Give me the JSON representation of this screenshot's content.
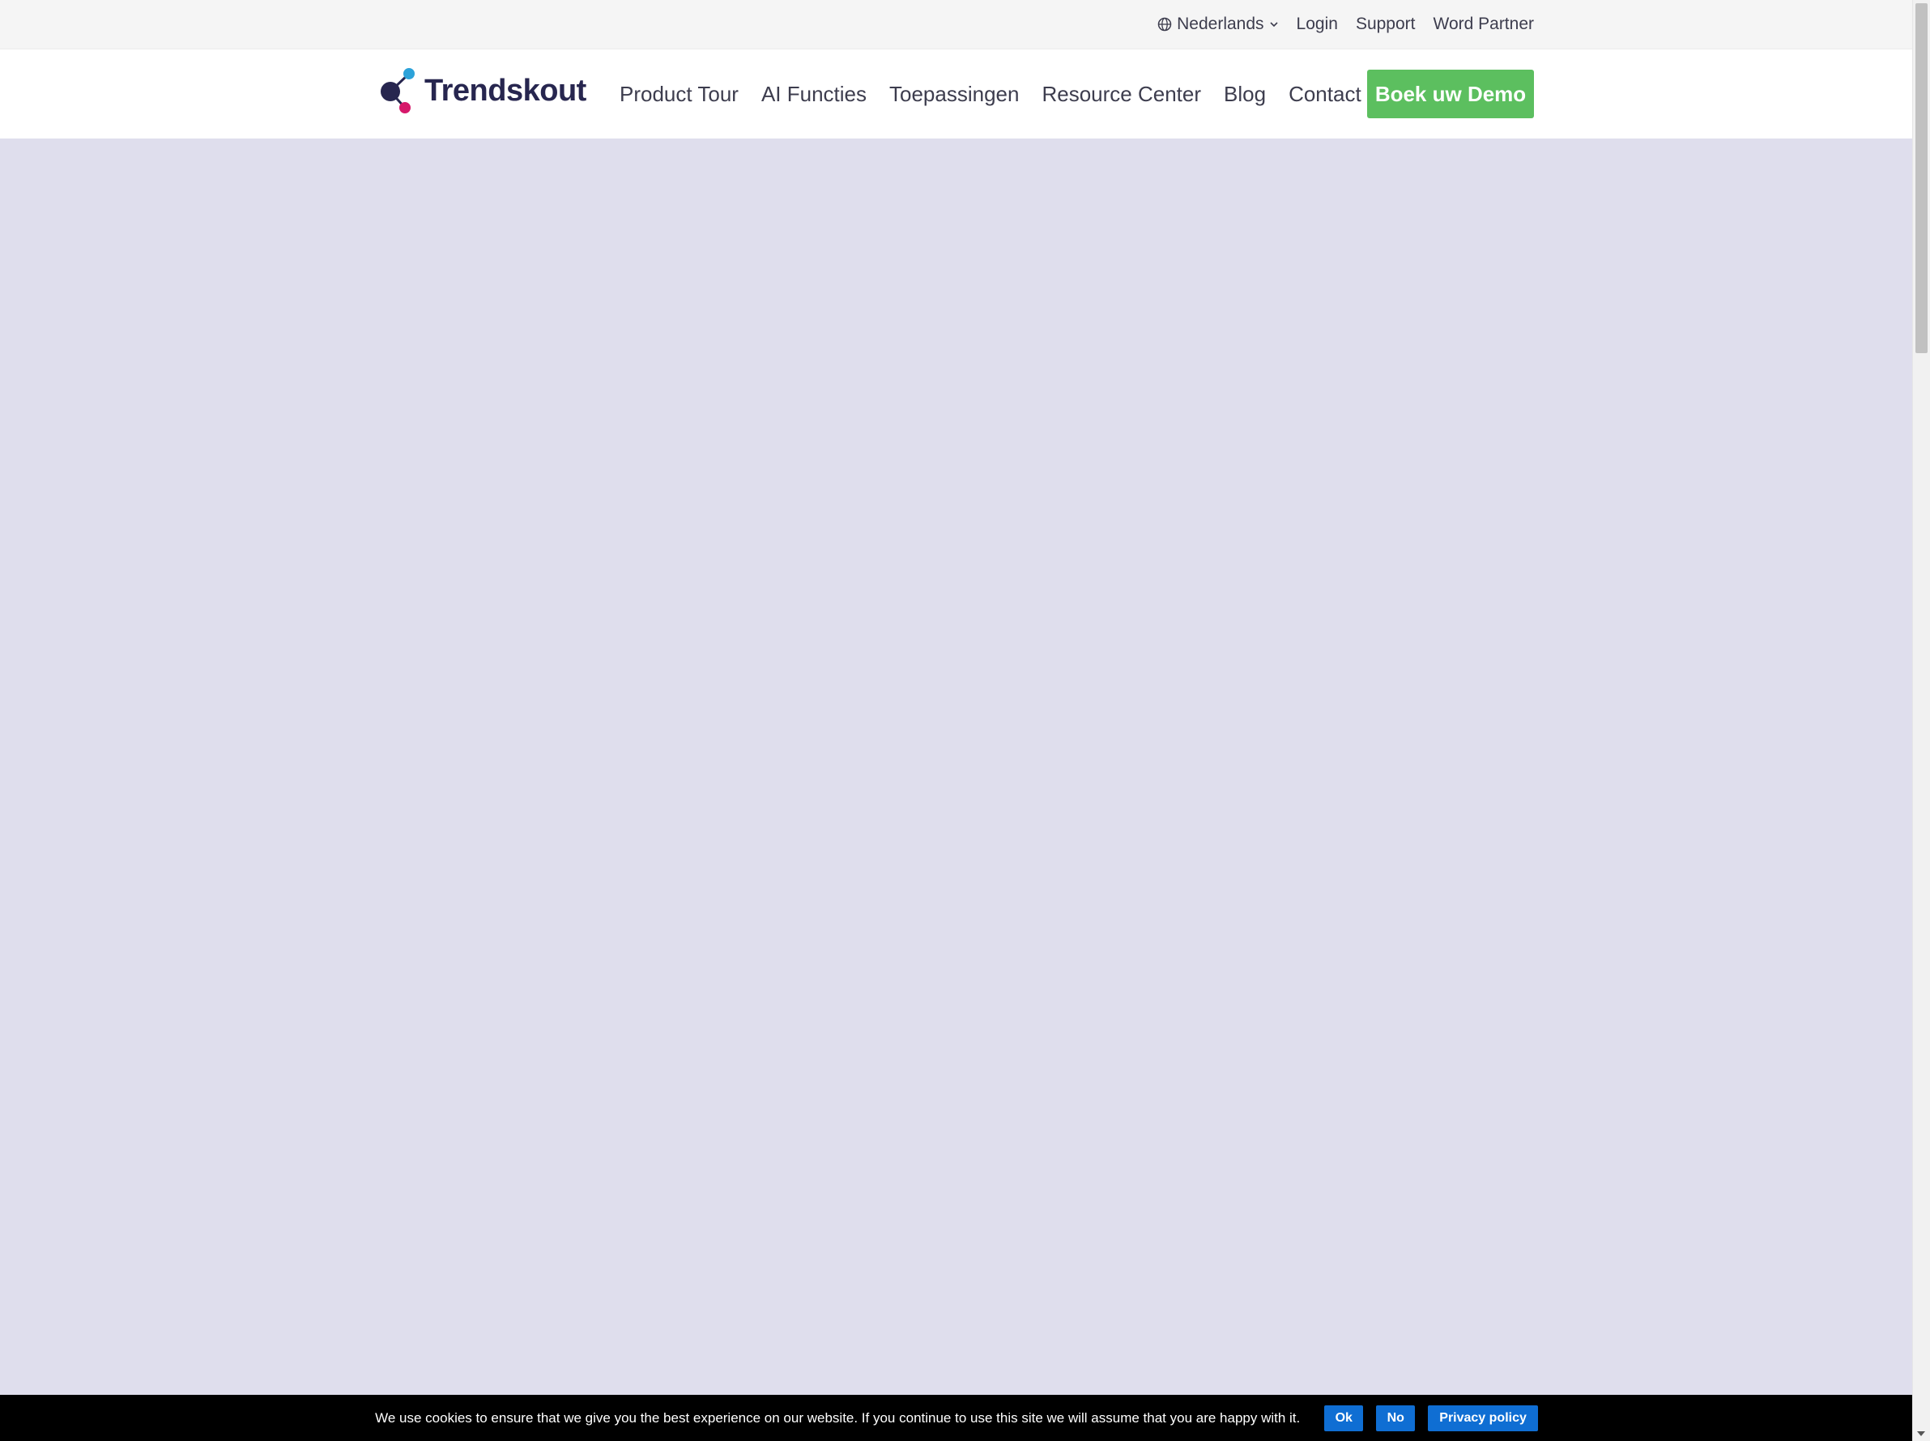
{
  "topbar": {
    "language": "Nederlands",
    "links": [
      "Login",
      "Support",
      "Word Partner"
    ]
  },
  "header": {
    "logo_text": "Trendskout",
    "nav": [
      "Product Tour",
      "AI Functies",
      "Toepassingen",
      "Resource Center",
      "Blog",
      "Contact"
    ],
    "cta": "Boek uw Demo"
  },
  "cookie": {
    "message": "We use cookies to ensure that we give you the best experience on our website. If you continue to use this site we will assume that you are happy with it.",
    "ok": "Ok",
    "no": "No",
    "privacy": "Privacy policy"
  },
  "colors": {
    "brand_dark": "#27264f",
    "brand_blue": "#2ca2d9",
    "brand_pink": "#d6196b",
    "cta_green": "#5cbf5f",
    "hero_bg": "#dfdeed",
    "cookie_btn": "#0f6ed3"
  },
  "icons": {
    "language": "globe-icon",
    "language_caret": "chevron-down-icon"
  }
}
